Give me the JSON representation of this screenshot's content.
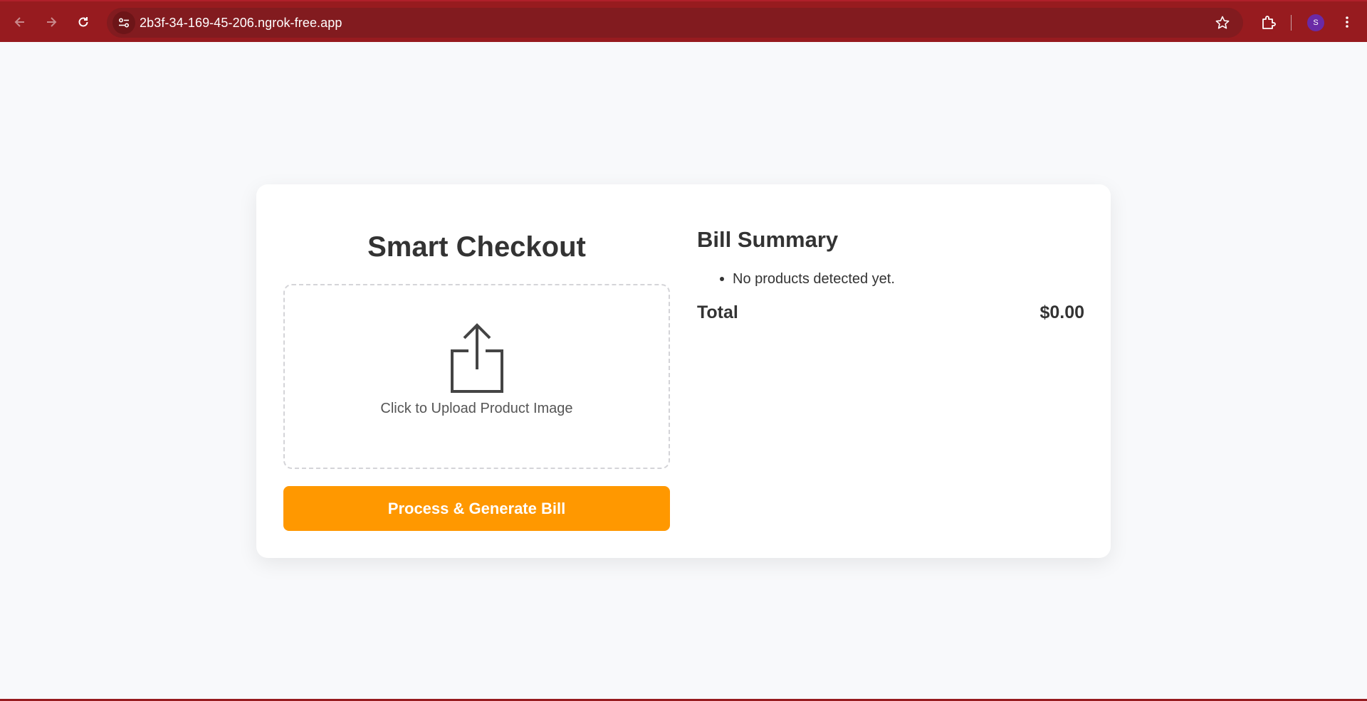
{
  "browser": {
    "url": "2b3f-34-169-45-206.ngrok-free.app",
    "profile_initial": "S",
    "icons": [
      "back-arrow-icon",
      "forward-arrow-icon",
      "reload-icon",
      "site-info-icon",
      "bookmark-star-icon",
      "extensions-icon",
      "more-menu-icon"
    ]
  },
  "app": {
    "title": "Smart Checkout",
    "upload_text": "Click to Upload Product Image",
    "process_button": "Process & Generate Bill"
  },
  "bill": {
    "title": "Bill Summary",
    "items": [
      "No products detected yet."
    ],
    "total_label": "Total",
    "total_value": "$0.00"
  },
  "colors": {
    "browser_chrome": "#971b1f",
    "accent_button": "#ff9800",
    "text": "#333333"
  }
}
